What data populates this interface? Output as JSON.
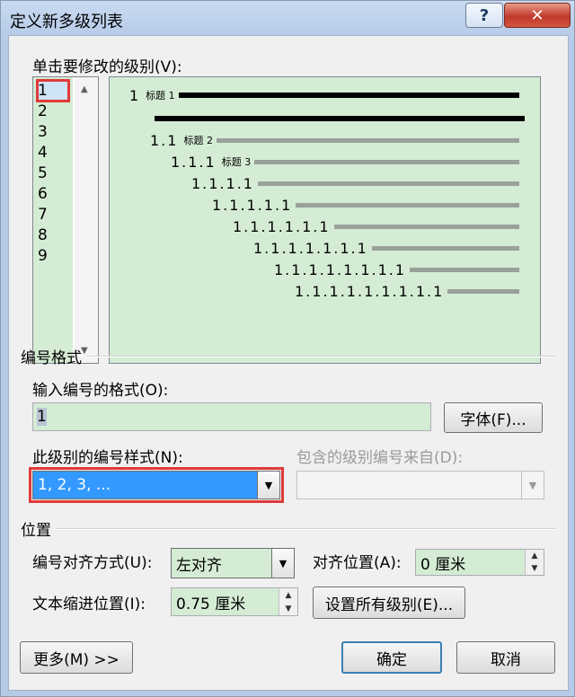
{
  "window": {
    "title": "定义新多级列表",
    "help": "?",
    "close": "✕"
  },
  "levels": {
    "label": "单击要修改的级别(V):",
    "items": [
      "1",
      "2",
      "3",
      "4",
      "5",
      "6",
      "7",
      "8",
      "9"
    ],
    "selected": "1"
  },
  "preview": {
    "rows": [
      {
        "num": "1",
        "heading": "标题 1",
        "thick": true
      },
      {
        "num": "",
        "heading": "",
        "thick": true
      },
      {
        "num": "1.1",
        "heading": "标题 2",
        "thick": false
      },
      {
        "num": "1.1.1",
        "heading": "标题 3",
        "thick": false
      },
      {
        "num": "1.1.1.1",
        "heading": "",
        "thick": false
      },
      {
        "num": "1.1.1.1.1",
        "heading": "",
        "thick": false
      },
      {
        "num": "1.1.1.1.1.1",
        "heading": "",
        "thick": false
      },
      {
        "num": "1.1.1.1.1.1.1",
        "heading": "",
        "thick": false
      },
      {
        "num": "1.1.1.1.1.1.1.1",
        "heading": "",
        "thick": false
      },
      {
        "num": "1.1.1.1.1.1.1.1.1",
        "heading": "",
        "thick": false
      }
    ]
  },
  "number_format": {
    "group": "编号格式",
    "format_label": "输入编号的格式(O):",
    "format_value": "1",
    "font_button": "字体(F)...",
    "style_label": "此级别的编号样式(N):",
    "style_value": "1, 2, 3, ...",
    "include_label": "包含的级别编号来自(D):",
    "include_value": ""
  },
  "position": {
    "group": "位置",
    "align_label": "编号对齐方式(U):",
    "align_value": "左对齐",
    "at_label": "对齐位置(A):",
    "at_value": "0 厘米",
    "indent_label": "文本缩进位置(I):",
    "indent_value": "0.75 厘米",
    "set_all_button": "设置所有级别(E)..."
  },
  "buttons": {
    "more": "更多(M) >>",
    "ok": "确定",
    "cancel": "取消"
  },
  "colors": {
    "field_bg": "#d4ecd4",
    "highlight_red": "#e03a3a",
    "selected_blue": "#3399ff"
  }
}
